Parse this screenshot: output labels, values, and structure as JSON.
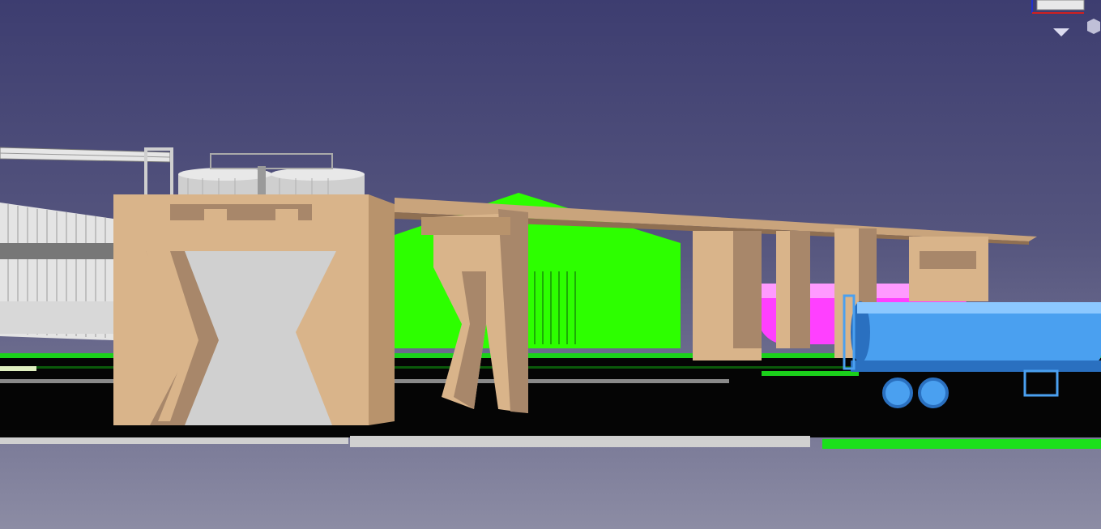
{
  "app": {
    "view": "3D viewport",
    "background_top": "#3d3d70",
    "background_bottom": "#8c8ca4"
  },
  "colors": {
    "concrete": "#d9b48a",
    "concrete_shade": "#a8876a",
    "green_building": "#2dff00",
    "silo": "#d8d8d8",
    "tanker": "#4aa0f0",
    "magenta_tank": "#ff40ff",
    "ground": "#050505",
    "road": "#c8c8c8"
  },
  "navigation": {
    "cube_icon": "navigation-cube-icon",
    "menu_icon": "chevron-down-icon",
    "view_icon": "view-cube-icon"
  }
}
